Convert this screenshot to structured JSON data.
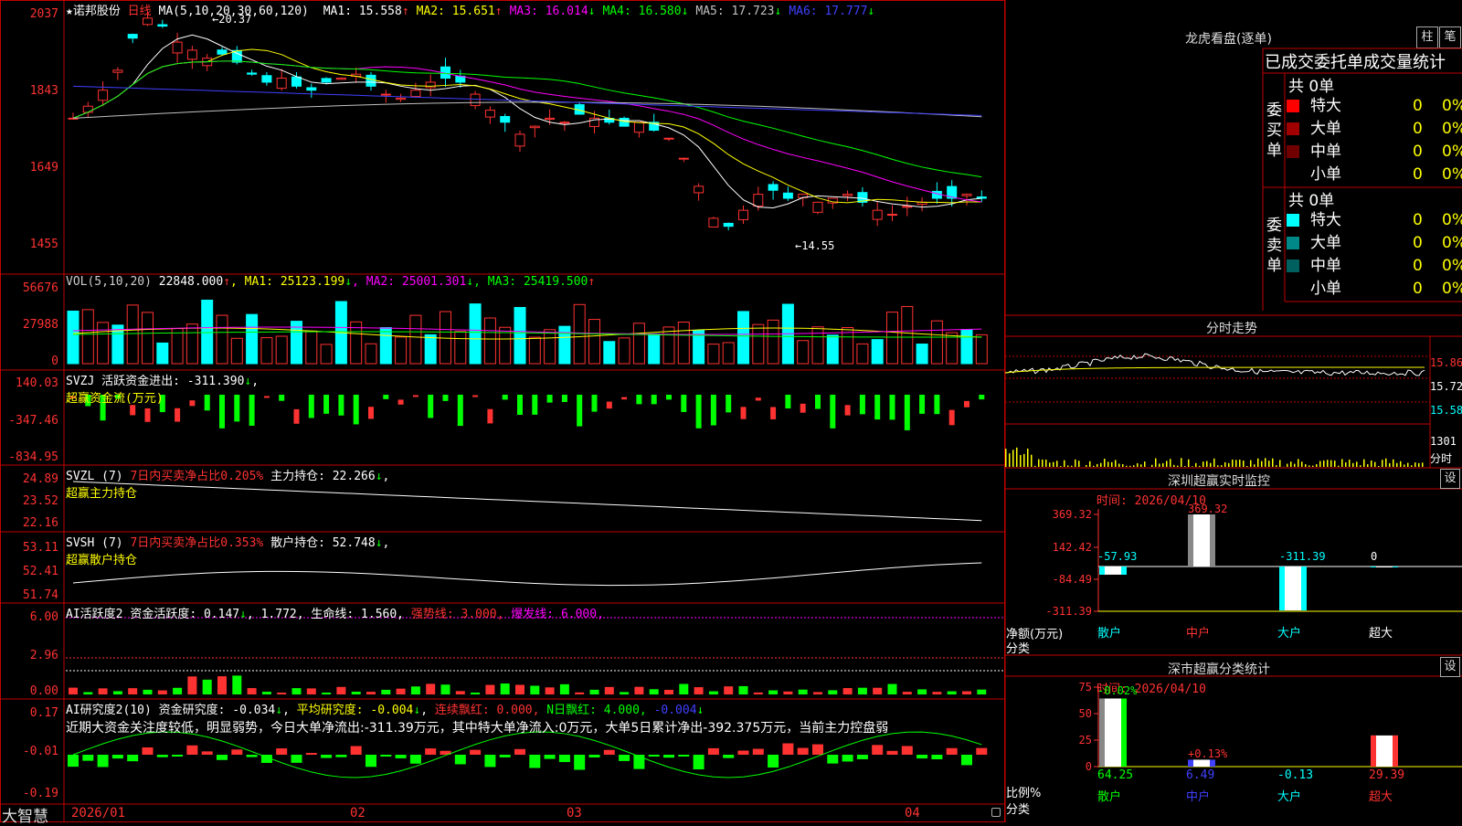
{
  "colors": {
    "up": "#ff3232",
    "down": "#00ffff",
    "bg": "#000000",
    "border": "#c00000",
    "yellow": "#ffff00",
    "magenta": "#ff00ff",
    "green": "#00ff00",
    "navy": "#4040ff",
    "gray": "#c0c0c0"
  },
  "main": {
    "star": "★",
    "stock_name": "诺邦股份",
    "period": "日线",
    "ma_title": "MA(5,10,20,30,60,120)",
    "ma_items": [
      {
        "label": "MA1: 15.558",
        "arrow": "↑",
        "color": "#ffffff"
      },
      {
        "label": "MA2: 15.651",
        "arrow": "↑",
        "color": "#ffff00"
      },
      {
        "label": "MA3: 16.014",
        "arrow": "↓",
        "color": "#ff00ff"
      },
      {
        "label": "MA4: 16.580",
        "arrow": "↓",
        "color": "#00ff00"
      },
      {
        "label": "MA5: 17.723",
        "arrow": "↓",
        "color": "#c0c0c0"
      },
      {
        "label": "MA6: 17.777",
        "arrow": "↓",
        "color": "#4040ff"
      }
    ],
    "y_ticks": [
      "2037",
      "1843",
      "1649",
      "1455"
    ],
    "high_label": "20.37",
    "low_label": "14.55"
  },
  "vol": {
    "header": "VOL(5,10,20)",
    "value": "22848.000",
    "value_arrow": "↑",
    "items": [
      {
        "label": "MA1: 25123.199",
        "arrow": "↓",
        "color": "#ffff00"
      },
      {
        "label": "MA2: 25001.301",
        "arrow": "↓",
        "color": "#ff00ff"
      },
      {
        "label": "MA3: 25419.500",
        "arrow": "↑",
        "color": "#00ff00"
      }
    ],
    "y_ticks": [
      "56676",
      "27988",
      "0"
    ]
  },
  "svzj": {
    "header": "SVZJ",
    "label": "活跃资金进出: -311.390",
    "arrow": "↓",
    "sub": "超赢资金流(万元)",
    "y_ticks": [
      "140.03",
      "-347.46",
      "-834.95"
    ]
  },
  "svzl": {
    "header": "SVZL (7)",
    "desc": "7日内买卖净占比0.205%",
    "label": "主力持仓: 22.266",
    "arrow": "↓",
    "sub": "超赢主力持仓",
    "y_ticks": [
      "24.89",
      "23.52",
      "22.16"
    ]
  },
  "svsh": {
    "header": "SVSH (7)",
    "desc": "7日内买卖净占比0.353%",
    "label": "散户持仓: 52.748",
    "arrow": "↓",
    "sub": "超赢散户持仓",
    "y_ticks": [
      "53.11",
      "52.41",
      "51.74"
    ]
  },
  "ai1": {
    "header": "AI活跃度2",
    "label": "资金活跃度: 0.147",
    "a1": "↓",
    "v2": "1.772",
    "a2": ",",
    "life": "生命线: 1.560,",
    "strong": "强势线: 3.000,",
    "burst": "爆发线: 6.000,",
    "y_ticks": [
      "6.00",
      "2.96",
      "0.00"
    ]
  },
  "ai2": {
    "header": "AI研究度2(10)",
    "label": "资金研究度: -0.034",
    "a1": "↓",
    "avg": "平均研究度: -0.004",
    "a2": "↓",
    "red": "连续飘红: 0.000,",
    "n_red": "N日飘红: 4.000,",
    "last": "-0.004",
    "a3": "↓",
    "comment": "近期大资金关注度较低，明显弱势，今日大单净流出:-311.39万元，其中特大单净流入:0万元，大单5日累计净出-392.375万元，当前主力控盘弱",
    "y_ticks": [
      "0.17",
      "-0.01",
      "-0.19"
    ]
  },
  "xaxis": {
    "labels": [
      "2026/01",
      "02",
      "03",
      "04"
    ]
  },
  "footer": {
    "brand": "大智慧"
  },
  "right": {
    "dragon_title": "龙虎看盘(逐单)",
    "tab1": "柱",
    "tab2": "笔",
    "tabs_row": "已成交委托单成交量统计",
    "buy": {
      "total": "共 0单",
      "side": "委买单",
      "rows": [
        {
          "name": "特大",
          "count": "0",
          "pct": "0%",
          "color": "#ff0000"
        },
        {
          "name": "大单",
          "count": "0",
          "pct": "0%",
          "color": "#a00000"
        },
        {
          "name": "中单",
          "count": "0",
          "pct": "0%",
          "color": "#700000"
        },
        {
          "name": "小单",
          "count": "0",
          "pct": "0%",
          "color": "#000000"
        }
      ]
    },
    "sell": {
      "total": "共 0单",
      "side": "委卖单",
      "rows": [
        {
          "name": "特大",
          "count": "0",
          "pct": "0%",
          "color": "#00ffff"
        },
        {
          "name": "大单",
          "count": "0",
          "pct": "0%",
          "color": "#008888"
        },
        {
          "name": "中单",
          "count": "0",
          "pct": "0%",
          "color": "#006060"
        },
        {
          "name": "小单",
          "count": "0",
          "pct": "0%",
          "color": "#000000"
        }
      ]
    },
    "intraday": {
      "title": "分时走势",
      "p1": "15.86",
      "p2": "15.72",
      "p3": "15.58",
      "vol": "1301",
      "vol_label": "分时"
    },
    "monitor": {
      "title": "深圳超赢实时监控",
      "set": "设",
      "time": "时间: 2026/04/10",
      "y_ticks": [
        "369.32",
        "142.42",
        "-84.49",
        "-311.39"
      ],
      "bar_labels": [
        "-57.93",
        "369.32",
        "-311.39",
        "0"
      ],
      "net_label": "净额(万元)",
      "cat_label": "分类",
      "cats": [
        "散户",
        "中户",
        "大户",
        "超大"
      ]
    },
    "classify": {
      "title": "深市超赢分类统计",
      "set": "设",
      "time": "时间: 2026/04/10",
      "y_ticks": [
        "75",
        "50",
        "25",
        "0"
      ],
      "top_labels": [
        "-0.02%",
        "+0.13%",
        "",
        ""
      ],
      "bottom_vals": [
        "64.25",
        "6.49",
        "-0.13",
        "29.39"
      ],
      "ratio_label": "比例%",
      "cat_label": "分类",
      "cats": [
        "散户",
        "中户",
        "大户",
        "超大"
      ]
    }
  }
}
